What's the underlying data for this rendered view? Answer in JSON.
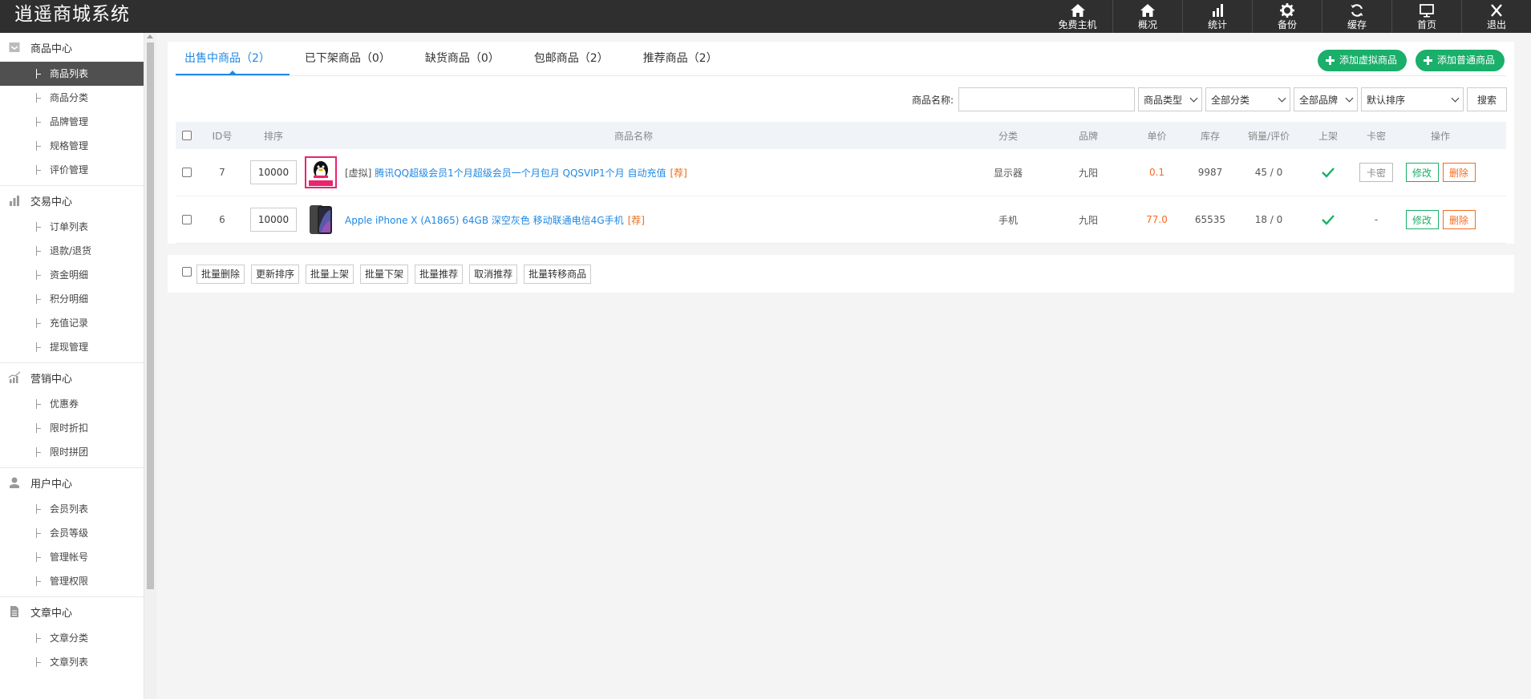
{
  "app": {
    "title": "逍遥商城系统"
  },
  "topnav": [
    {
      "label": "免费主机",
      "icon": "home-icon"
    },
    {
      "label": "概况",
      "icon": "home-icon"
    },
    {
      "label": "统计",
      "icon": "bar-chart-icon"
    },
    {
      "label": "备份",
      "icon": "gear-icon"
    },
    {
      "label": "缓存",
      "icon": "refresh-icon"
    },
    {
      "label": "首页",
      "icon": "monitor-icon"
    },
    {
      "label": "退出",
      "icon": "close-icon"
    }
  ],
  "sidebar": {
    "groups": [
      {
        "title": "商品中心",
        "icon": "box-icon",
        "items": [
          "商品列表",
          "商品分类",
          "品牌管理",
          "规格管理",
          "评价管理"
        ]
      },
      {
        "title": "交易中心",
        "icon": "bar-chart-icon",
        "items": [
          "订单列表",
          "退款/退货",
          "资金明细",
          "积分明细",
          "充值记录",
          "提现管理"
        ]
      },
      {
        "title": "营销中心",
        "icon": "trend-chart-icon",
        "items": [
          "优惠券",
          "限时折扣",
          "限时拼团"
        ]
      },
      {
        "title": "用户中心",
        "icon": "user-icon",
        "items": [
          "会员列表",
          "会员等级",
          "管理帐号",
          "管理权限"
        ]
      },
      {
        "title": "文章中心",
        "icon": "document-icon",
        "items": [
          "文章分类",
          "文章列表"
        ]
      }
    ],
    "active_item": "商品列表"
  },
  "tabs": [
    {
      "label": "出售中商品（2）",
      "active": true
    },
    {
      "label": "已下架商品（0）",
      "active": false
    },
    {
      "label": "缺货商品（0）",
      "active": false
    },
    {
      "label": "包邮商品（2）",
      "active": false
    },
    {
      "label": "推荐商品（2）",
      "active": false
    }
  ],
  "actions": {
    "add_virtual": "添加虚拟商品",
    "add_normal": "添加普通商品"
  },
  "filters": {
    "name_label": "商品名称:",
    "name_value": "",
    "type_select": "商品类型",
    "category_select": "全部分类",
    "brand_select": "全部品牌",
    "sort_select": "默认排序",
    "search_button": "搜索"
  },
  "table": {
    "headers": {
      "id": "ID号",
      "sort": "排序",
      "name": "商品名称",
      "category": "分类",
      "brand": "品牌",
      "price": "单价",
      "stock": "库存",
      "sales": "销量/评价",
      "shelf": "上架",
      "card": "卡密",
      "ops": "操作"
    },
    "rows": [
      {
        "id": "7",
        "sort": "10000",
        "tag": "[虚拟]",
        "name": "腾讯QQ超级会员1个月超级会员一个月包月 QQSVIP1个月 自动充值",
        "rec": "[荐]",
        "category": "显示器",
        "brand": "九阳",
        "price": "0.1",
        "stock": "9987",
        "sales": "45 / 0",
        "card": "卡密",
        "thumb": "qq-penguin-image"
      },
      {
        "id": "6",
        "sort": "10000",
        "tag": "",
        "name": "Apple iPhone X (A1865) 64GB 深空灰色 移动联通电信4G手机",
        "rec": "[荐]",
        "category": "手机",
        "brand": "九阳",
        "price": "77.0",
        "stock": "65535",
        "sales": "18 / 0",
        "card": "-",
        "thumb": "iphone-image"
      }
    ],
    "edit_label": "修改",
    "delete_label": "删除"
  },
  "batch": [
    "批量删除",
    "更新排序",
    "批量上架",
    "批量下架",
    "批量推荐",
    "取消推荐",
    "批量转移商品"
  ],
  "colors": {
    "accent": "#1e88e5",
    "green": "#1aaf6a",
    "orange": "#f36c21",
    "topbar": "#2f2f2f"
  }
}
